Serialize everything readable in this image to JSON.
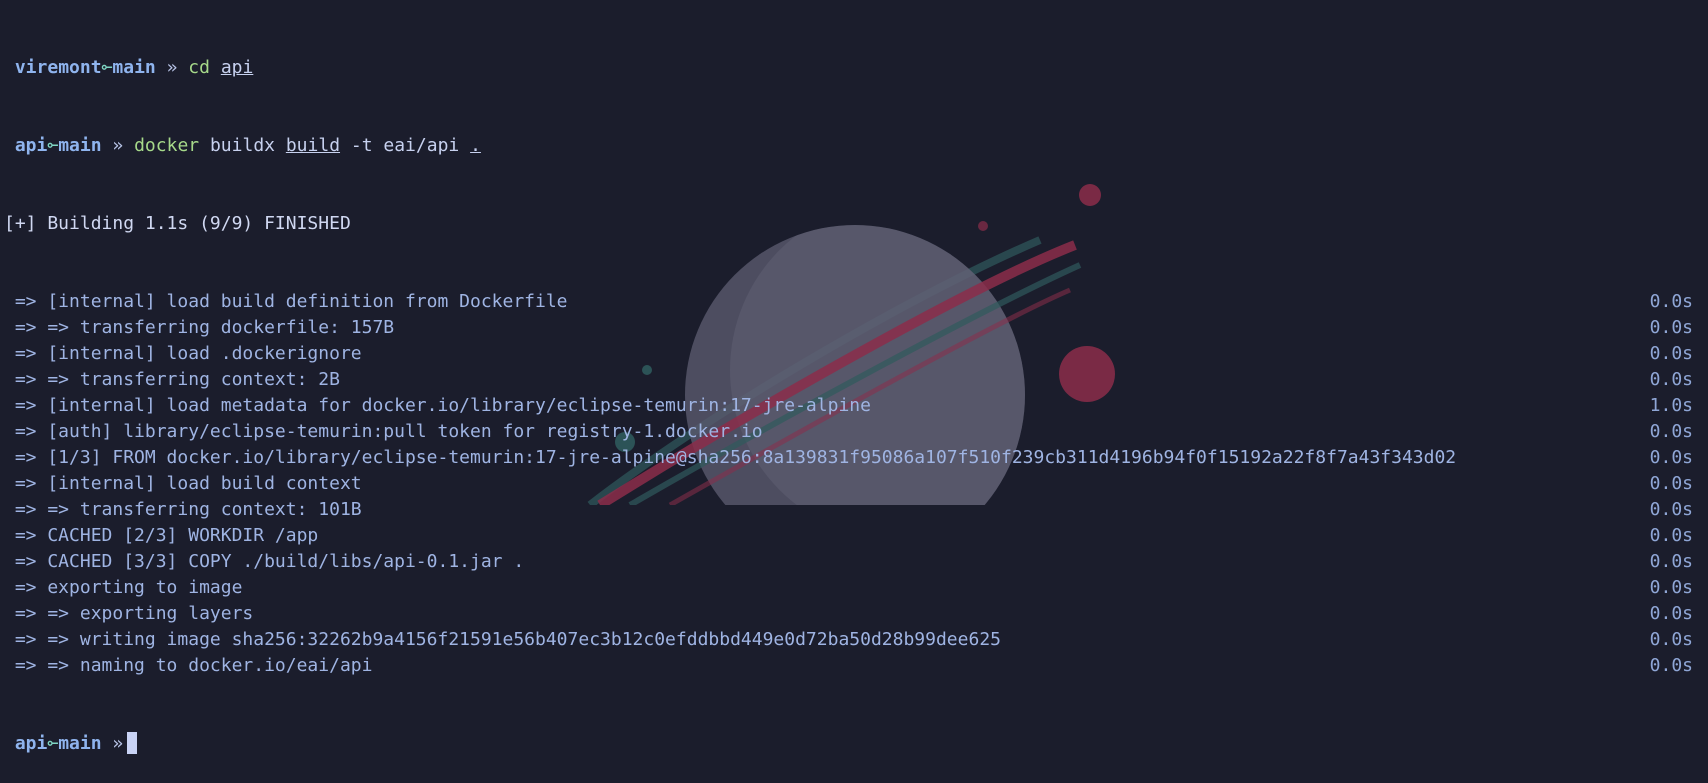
{
  "colors": {
    "background": "#1b1d2c",
    "prompt_dir": "#8fb4ee",
    "git_symbol": "#7fd6c4",
    "command": "#a6d98a",
    "output": "#9fb4e3",
    "cursor": "#c9d3f5",
    "planet": "#5a5a6e",
    "ring_red": "#8b2d4a",
    "ring_teal": "#2f5a5c"
  },
  "prompt1": {
    "dir": "viremont",
    "symbol": "⟜",
    "branch": "main",
    "arrow": "»",
    "cmd": "cd",
    "arg": "api"
  },
  "prompt2": {
    "dir": "api",
    "symbol": "⟜",
    "branch": "main",
    "arrow": "»",
    "cmd": "docker",
    "sub": "buildx",
    "sub2": "build",
    "args": "-t eai/api",
    "dot": "."
  },
  "build_header": "[+] Building 1.1s (9/9) FINISHED",
  "steps": [
    {
      "text": " => [internal] load build definition from Dockerfile",
      "time": "0.0s"
    },
    {
      "text": " => => transferring dockerfile: 157B",
      "time": "0.0s"
    },
    {
      "text": " => [internal] load .dockerignore",
      "time": "0.0s"
    },
    {
      "text": " => => transferring context: 2B",
      "time": "0.0s"
    },
    {
      "text": " => [internal] load metadata for docker.io/library/eclipse-temurin:17-jre-alpine",
      "time": "1.0s"
    },
    {
      "text": " => [auth] library/eclipse-temurin:pull token for registry-1.docker.io",
      "time": "0.0s"
    },
    {
      "text": " => [1/3] FROM docker.io/library/eclipse-temurin:17-jre-alpine@sha256:8a139831f95086a107f510f239cb311d4196b94f0f15192a22f8f7a43f343d02",
      "time": "0.0s"
    },
    {
      "text": " => [internal] load build context",
      "time": "0.0s"
    },
    {
      "text": " => => transferring context: 101B",
      "time": "0.0s"
    },
    {
      "text": " => CACHED [2/3] WORKDIR /app",
      "time": "0.0s"
    },
    {
      "text": " => CACHED [3/3] COPY ./build/libs/api-0.1.jar .",
      "time": "0.0s"
    },
    {
      "text": " => exporting to image",
      "time": "0.0s"
    },
    {
      "text": " => => exporting layers",
      "time": "0.0s"
    },
    {
      "text": " => => writing image sha256:32262b9a4156f21591e56b407ec3b12c0efddbbd449e0d72ba50d28b99dee625",
      "time": "0.0s"
    },
    {
      "text": " => => naming to docker.io/eai/api",
      "time": "0.0s"
    }
  ],
  "prompt3": {
    "dir": "api",
    "symbol": "⟜",
    "branch": "main",
    "arrow": "»"
  }
}
